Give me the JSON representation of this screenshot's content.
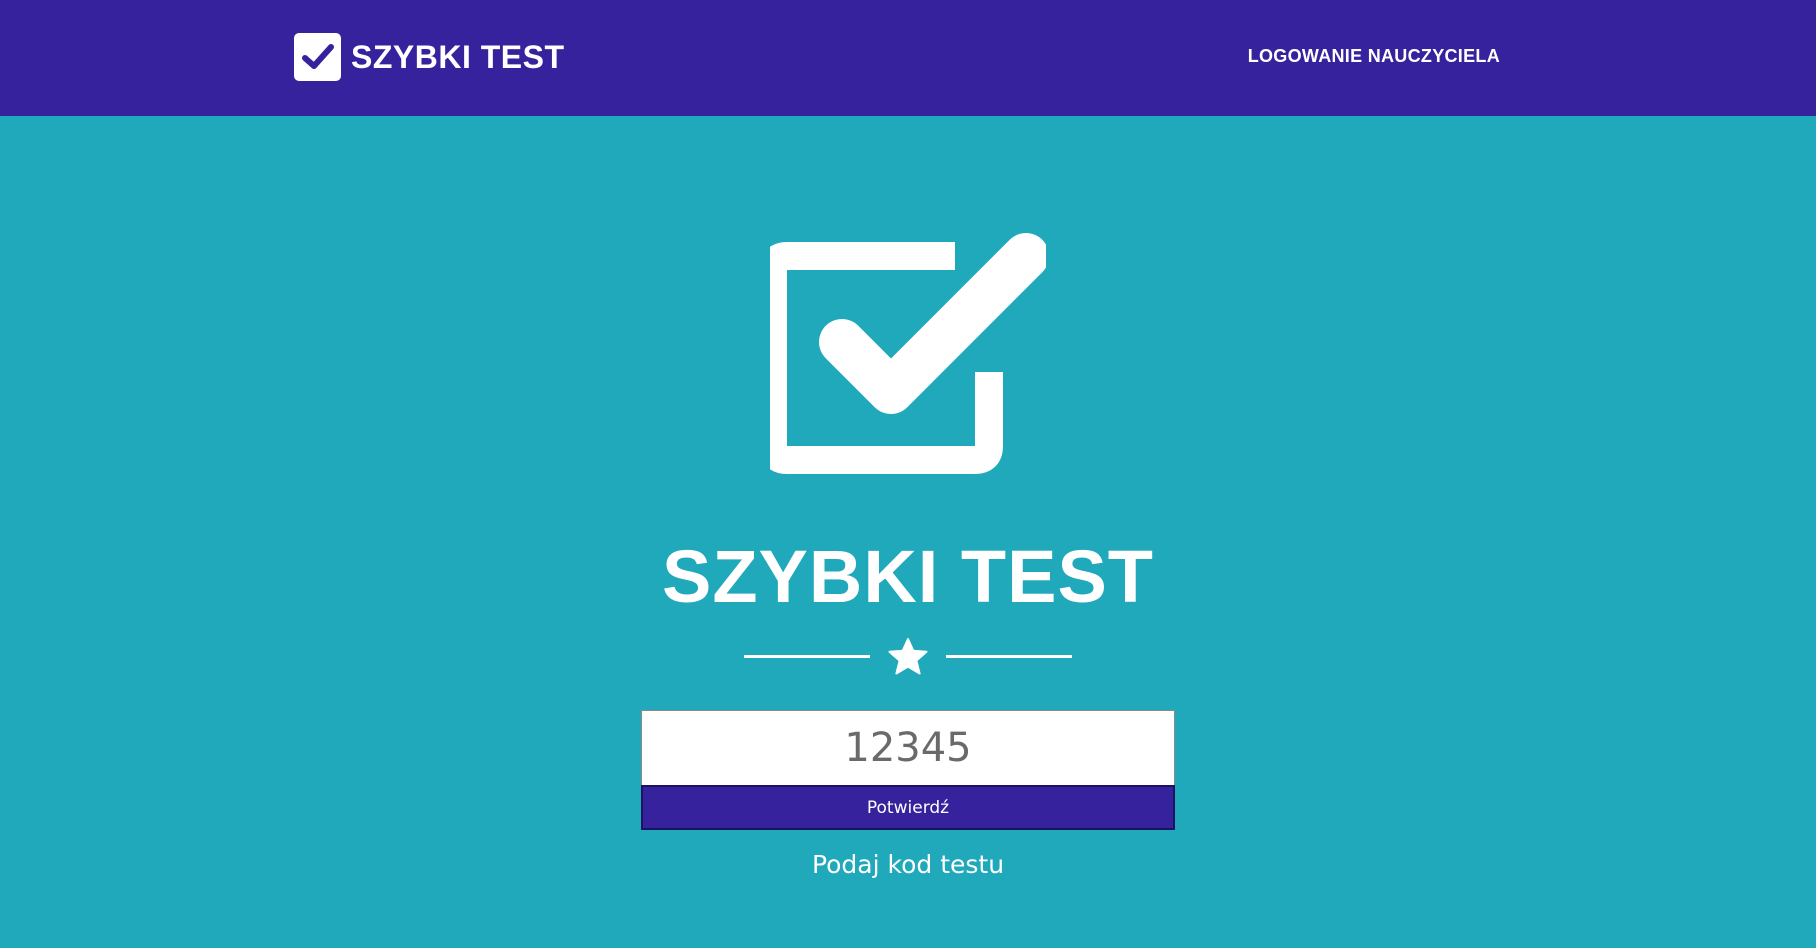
{
  "header": {
    "brand_icon": "checkbox-check-icon",
    "brand_label": "SZYBKI TEST",
    "teacher_login_label": "LOGOWANIE NAUCZYCIELA"
  },
  "hero": {
    "icon": "checkbox-check-icon",
    "title": "SZYBKI TEST",
    "divider_icon": "star-icon"
  },
  "form": {
    "code_value": "12345",
    "submit_label": "Potwierdź",
    "hint": "Podaj kod testu"
  },
  "colors": {
    "header_bg": "#37229d",
    "page_bg": "#1fa9bb",
    "button_bg": "#37229d",
    "text": "#ffffff"
  }
}
